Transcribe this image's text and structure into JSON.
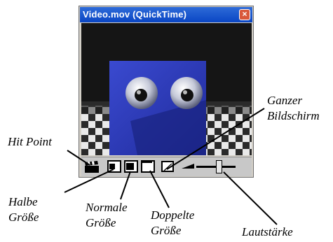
{
  "window": {
    "title": "Video.mov (QuickTime)",
    "close_glyph": "×"
  },
  "controls": {
    "hit_point_icon": "clapperboard-icon",
    "half_size_icon": "half-size-icon",
    "normal_size_icon": "normal-size-icon",
    "double_size_icon": "double-size-icon",
    "fullscreen_icon": "fullscreen-icon",
    "volume_icon": "volume-icon",
    "volume_level": 0.6
  },
  "annotations": {
    "hit_point": "Hit Point",
    "half_size": [
      "Halbe",
      "Größe"
    ],
    "normal_size": [
      "Normale",
      "Größe"
    ],
    "double_size": [
      "Doppelte",
      "Größe"
    ],
    "fullscreen": [
      "Ganzer",
      "Bildschirm"
    ],
    "volume": "Lautstärke"
  },
  "colors": {
    "title_bar": "#0a46c4",
    "close_button": "#d9583a",
    "video_cube": "#2f3fc0"
  }
}
